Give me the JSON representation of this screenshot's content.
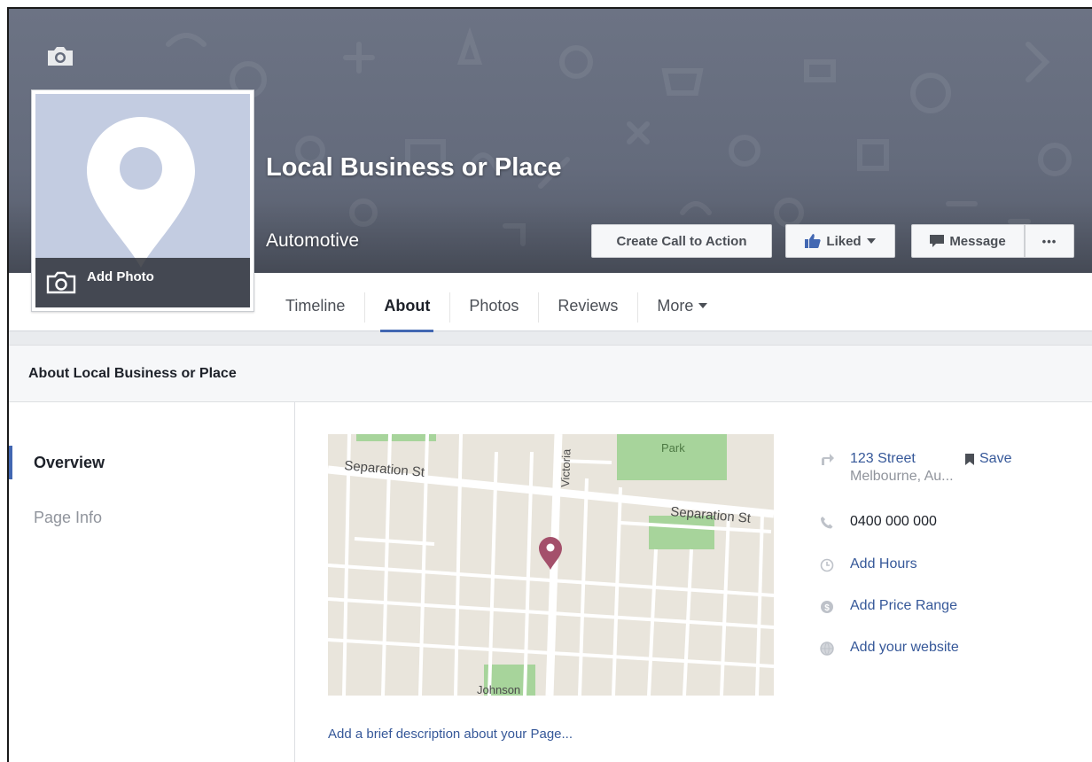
{
  "page": {
    "name": "Local Business or Place",
    "category": "Automotive",
    "add_photo_label": "Add Photo"
  },
  "actions": {
    "cta_label": "Create Call to Action",
    "liked_label": "Liked",
    "message_label": "Message",
    "more_label": "•••"
  },
  "tabs": [
    {
      "label": "Timeline",
      "active": false
    },
    {
      "label": "About",
      "active": true
    },
    {
      "label": "Photos",
      "active": false
    },
    {
      "label": "Reviews",
      "active": false
    },
    {
      "label": "More",
      "active": false
    }
  ],
  "about": {
    "heading": "About Local Business or Place",
    "sidebar": [
      {
        "label": "Overview",
        "active": true
      },
      {
        "label": "Page Info",
        "active": false
      }
    ],
    "map_labels": {
      "street_1": "Separation St",
      "street_2": "Separation St",
      "street_3": "Victoria",
      "park": "Park",
      "street_4": "Johnson"
    },
    "description_prompt": "Add a brief description about your Page...",
    "address_line1": "123 Street",
    "address_line2": "Melbourne, Au...",
    "save_label": "Save",
    "phone": "0400 000 000",
    "hours_link": "Add Hours",
    "price_link": "Add Price Range",
    "website_link": "Add your website"
  },
  "colors": {
    "accent": "#4267b2",
    "link": "#365899",
    "cover": "#646b7c",
    "map_pin": "#a4506b",
    "park": "#a7d49b"
  }
}
